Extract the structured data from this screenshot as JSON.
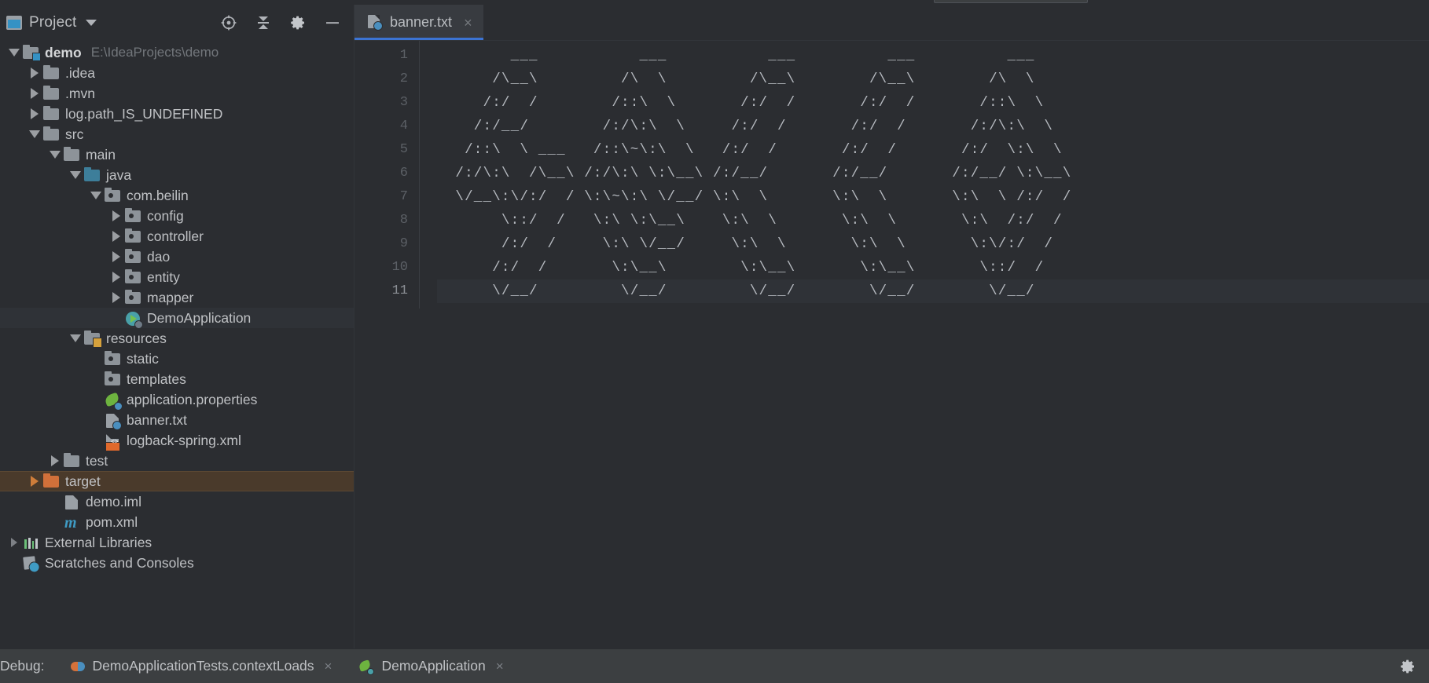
{
  "window": {
    "theme_bg": "#2b2d31",
    "accent": "#3c74d4"
  },
  "project_panel": {
    "title": "Project",
    "caret_icon": "chevron-down-icon",
    "toolbar_icons": [
      {
        "name": "locate-icon",
        "title": "Select Opened File"
      },
      {
        "name": "collapse-all-icon",
        "title": "Collapse All"
      },
      {
        "name": "gear-icon",
        "title": "Settings"
      },
      {
        "name": "minimize-icon",
        "title": "Hide"
      }
    ],
    "tree": [
      {
        "label": "demo",
        "sub": "E:\\IdeaProjects\\demo",
        "icon": "module-folder-icon",
        "indent": 0,
        "twisty": "down",
        "bold": true,
        "state": "normal"
      },
      {
        "label": ".idea",
        "sub": "",
        "icon": "folder-icon",
        "indent": 1,
        "twisty": "right",
        "bold": false,
        "state": "normal"
      },
      {
        "label": ".mvn",
        "sub": "",
        "icon": "folder-icon",
        "indent": 1,
        "twisty": "right",
        "bold": false,
        "state": "normal"
      },
      {
        "label": "log.path_IS_UNDEFINED",
        "sub": "",
        "icon": "folder-icon",
        "indent": 1,
        "twisty": "right",
        "bold": false,
        "state": "normal"
      },
      {
        "label": "src",
        "sub": "",
        "icon": "folder-icon",
        "indent": 1,
        "twisty": "down",
        "bold": false,
        "state": "normal"
      },
      {
        "label": "main",
        "sub": "",
        "icon": "folder-icon",
        "indent": 2,
        "twisty": "down",
        "bold": false,
        "state": "normal"
      },
      {
        "label": "java",
        "sub": "",
        "icon": "source-root-folder-icon",
        "indent": 3,
        "twisty": "down",
        "bold": false,
        "state": "normal"
      },
      {
        "label": "com.beilin",
        "sub": "",
        "icon": "package-folder-icon",
        "indent": 4,
        "twisty": "down",
        "bold": false,
        "state": "normal"
      },
      {
        "label": "config",
        "sub": "",
        "icon": "package-folder-icon",
        "indent": 5,
        "twisty": "right",
        "bold": false,
        "state": "normal"
      },
      {
        "label": "controller",
        "sub": "",
        "icon": "package-folder-icon",
        "indent": 5,
        "twisty": "right",
        "bold": false,
        "state": "normal"
      },
      {
        "label": "dao",
        "sub": "",
        "icon": "package-folder-icon",
        "indent": 5,
        "twisty": "right",
        "bold": false,
        "state": "normal"
      },
      {
        "label": "entity",
        "sub": "",
        "icon": "package-folder-icon",
        "indent": 5,
        "twisty": "right",
        "bold": false,
        "state": "normal"
      },
      {
        "label": "mapper",
        "sub": "",
        "icon": "package-folder-icon",
        "indent": 5,
        "twisty": "right",
        "bold": false,
        "state": "normal"
      },
      {
        "label": "DemoApplication",
        "sub": "",
        "icon": "spring-boot-class-icon",
        "indent": 5,
        "twisty": "none",
        "bold": false,
        "state": "selected"
      },
      {
        "label": "resources",
        "sub": "",
        "icon": "resources-folder-icon",
        "indent": 3,
        "twisty": "down",
        "bold": false,
        "state": "normal"
      },
      {
        "label": "static",
        "sub": "",
        "icon": "package-folder-icon",
        "indent": 4,
        "twisty": "none",
        "bold": false,
        "state": "normal"
      },
      {
        "label": "templates",
        "sub": "",
        "icon": "package-folder-icon",
        "indent": 4,
        "twisty": "none",
        "bold": false,
        "state": "normal"
      },
      {
        "label": "application.properties",
        "sub": "",
        "icon": "spring-properties-icon",
        "indent": 4,
        "twisty": "none",
        "bold": false,
        "state": "normal"
      },
      {
        "label": "banner.txt",
        "sub": "",
        "icon": "text-file-icon",
        "indent": 4,
        "twisty": "none",
        "bold": false,
        "state": "normal"
      },
      {
        "label": "logback-spring.xml",
        "sub": "",
        "icon": "xml-file-icon",
        "indent": 4,
        "twisty": "none",
        "bold": false,
        "state": "normal"
      },
      {
        "label": "test",
        "sub": "",
        "icon": "folder-icon",
        "indent": 2,
        "twisty": "right",
        "bold": false,
        "state": "normal"
      },
      {
        "label": "target",
        "sub": "",
        "icon": "excluded-folder-icon",
        "indent": 1,
        "twisty": "right-orange",
        "bold": false,
        "state": "highlighted"
      },
      {
        "label": "demo.iml",
        "sub": "",
        "icon": "iml-file-icon",
        "indent": 2,
        "twisty": "none",
        "bold": false,
        "state": "normal"
      },
      {
        "label": "pom.xml",
        "sub": "",
        "icon": "maven-file-icon",
        "indent": 2,
        "twisty": "none",
        "bold": false,
        "state": "normal"
      },
      {
        "label": "External Libraries",
        "sub": "",
        "icon": "external-libraries-icon",
        "indent": 0,
        "twisty": "right-dim",
        "bold": false,
        "state": "normal"
      },
      {
        "label": "Scratches and Consoles",
        "sub": "",
        "icon": "scratches-icon",
        "indent": 0,
        "twisty": "none",
        "bold": false,
        "state": "normal"
      }
    ]
  },
  "editor": {
    "tabs": [
      {
        "label": "banner.txt",
        "icon": "text-file-icon",
        "close_glyph": "×",
        "active": true
      }
    ],
    "line_numbers": [
      "1",
      "2",
      "3",
      "4",
      "5",
      "6",
      "7",
      "8",
      "9",
      "10",
      "11"
    ],
    "highlighted_line": 11,
    "content_lines": [
      "        ___           ___           ___          ___          ___     ",
      "      /\\__\\         /\\  \\         /\\__\\        /\\__\\        /\\  \\    ",
      "     /:/  /        /::\\  \\       /:/  /       /:/  /       /::\\  \\   ",
      "    /:/__/        /:/\\:\\  \\     /:/  /       /:/  /       /:/\\:\\  \\  ",
      "   /::\\  \\ ___   /::\\~\\:\\  \\   /:/  /       /:/  /       /:/  \\:\\  \\ ",
      "  /:/\\:\\  /\\__\\ /:/\\:\\ \\:\\__\\ /:/__/       /:/__/       /:/__/ \\:\\__\\",
      "  \\/__\\:\\/:/  / \\:\\~\\:\\ \\/__/ \\:\\  \\       \\:\\  \\       \\:\\  \\ /:/  /",
      "       \\::/  /   \\:\\ \\:\\__\\    \\:\\  \\       \\:\\  \\       \\:\\  /:/  / ",
      "       /:/  /     \\:\\ \\/__/     \\:\\  \\       \\:\\  \\       \\:\\/:/  /  ",
      "      /:/  /       \\:\\__\\        \\:\\__\\       \\:\\__\\       \\::/  /   ",
      "      \\/__/         \\/__/         \\/__/        \\/__/        \\/__/    "
    ]
  },
  "debug_bar": {
    "label": "Debug:",
    "sessions": [
      {
        "label": "DemoApplicationTests.contextLoads",
        "icon": "junit-icon",
        "close_glyph": "×"
      },
      {
        "label": "DemoApplication",
        "icon": "spring-boot-icon",
        "close_glyph": "×"
      }
    ],
    "settings_icon": "gear-icon"
  }
}
